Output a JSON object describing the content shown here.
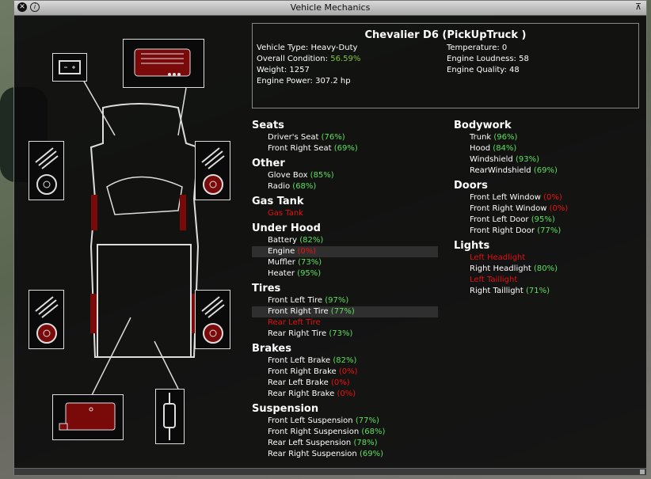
{
  "window": {
    "title": "Vehicle Mechanics"
  },
  "vehicle": {
    "name": "Chevalier D6 (PickUpTruck )",
    "type_label": "Vehicle Type:",
    "type_value": "Heavy-Duty",
    "cond_label": "Overall Condition:",
    "cond_value": "56.59%",
    "weight_label": "Weight:",
    "weight_value": "1257",
    "power_label": "Engine Power:",
    "power_value": "307.2 hp",
    "temp_label": "Temperature:",
    "temp_value": "0",
    "loud_label": "Engine Loudness:",
    "loud_value": "58",
    "quality_label": "Engine Quality:",
    "quality_value": "48"
  },
  "left_sections": [
    {
      "title": "Seats",
      "items": [
        {
          "label": "Driver's Seat",
          "pct": "(76%)",
          "state": "ok"
        },
        {
          "label": "Front Right Seat",
          "pct": "(69%)",
          "state": "ok"
        }
      ]
    },
    {
      "title": "Other",
      "items": [
        {
          "label": "Glove Box",
          "pct": "(85%)",
          "state": "ok"
        },
        {
          "label": "Radio",
          "pct": "(68%)",
          "state": "ok"
        }
      ]
    },
    {
      "title": "Gas Tank",
      "items": [
        {
          "label": "Gas Tank",
          "pct": "",
          "state": "missing"
        }
      ]
    },
    {
      "title": "Under Hood",
      "items": [
        {
          "label": "Battery",
          "pct": "(82%)",
          "state": "ok"
        },
        {
          "label": "Engine",
          "pct": "(0%)",
          "state": "broken",
          "hl": true
        },
        {
          "label": "Muffler",
          "pct": "(73%)",
          "state": "ok"
        },
        {
          "label": "Heater",
          "pct": "(95%)",
          "state": "ok"
        }
      ]
    },
    {
      "title": "Tires",
      "items": [
        {
          "label": "Front Left Tire",
          "pct": "(97%)",
          "state": "ok"
        },
        {
          "label": "Front Right Tire",
          "pct": "(77%)",
          "state": "ok",
          "hl": true
        },
        {
          "label": "Rear Left Tire",
          "pct": "",
          "state": "missing"
        },
        {
          "label": "Rear Right Tire",
          "pct": "(73%)",
          "state": "ok"
        }
      ]
    },
    {
      "title": "Brakes",
      "items": [
        {
          "label": "Front Left Brake",
          "pct": "(82%)",
          "state": "ok"
        },
        {
          "label": "Front Right Brake",
          "pct": "(0%)",
          "state": "broken"
        },
        {
          "label": "Rear Left Brake",
          "pct": "(0%)",
          "state": "broken"
        },
        {
          "label": "Rear Right Brake",
          "pct": "(0%)",
          "state": "broken"
        }
      ]
    },
    {
      "title": "Suspension",
      "items": [
        {
          "label": "Front Left Suspension",
          "pct": "(77%)",
          "state": "ok"
        },
        {
          "label": "Front Right Suspension",
          "pct": "(68%)",
          "state": "ok"
        },
        {
          "label": "Rear Left Suspension",
          "pct": "(78%)",
          "state": "ok"
        },
        {
          "label": "Rear Right Suspension",
          "pct": "(69%)",
          "state": "ok"
        }
      ]
    }
  ],
  "right_sections": [
    {
      "title": "Bodywork",
      "items": [
        {
          "label": "Trunk",
          "pct": "(96%)",
          "state": "ok"
        },
        {
          "label": "Hood",
          "pct": "(84%)",
          "state": "ok"
        },
        {
          "label": "Windshield",
          "pct": "(93%)",
          "state": "ok"
        },
        {
          "label": "RearWindshield",
          "pct": "(69%)",
          "state": "ok"
        }
      ]
    },
    {
      "title": "Doors",
      "items": [
        {
          "label": "Front Left Window",
          "pct": "(0%)",
          "state": "broken"
        },
        {
          "label": "Front Right Window",
          "pct": "(0%)",
          "state": "broken"
        },
        {
          "label": "Front Left Door",
          "pct": "(95%)",
          "state": "ok"
        },
        {
          "label": "Front Right Door",
          "pct": "(77%)",
          "state": "ok"
        }
      ]
    },
    {
      "title": "Lights",
      "items": [
        {
          "label": "Left Headlight",
          "pct": "",
          "state": "missing"
        },
        {
          "label": "Right Headlight",
          "pct": "(80%)",
          "state": "ok"
        },
        {
          "label": "Left Taillight",
          "pct": "",
          "state": "missing"
        },
        {
          "label": "Right Taillight",
          "pct": "(71%)",
          "state": "ok"
        }
      ]
    }
  ],
  "colors": {
    "ok": "#5ee05e",
    "broken": "#e11111",
    "part_fill": "#7a0a0a"
  },
  "icons": [
    "close-icon",
    "info-icon",
    "pin-icon",
    "battery-icon",
    "engine-icon",
    "brake-disc-icon",
    "suspension-spring-icon",
    "gas-tank-icon",
    "muffler-icon"
  ]
}
